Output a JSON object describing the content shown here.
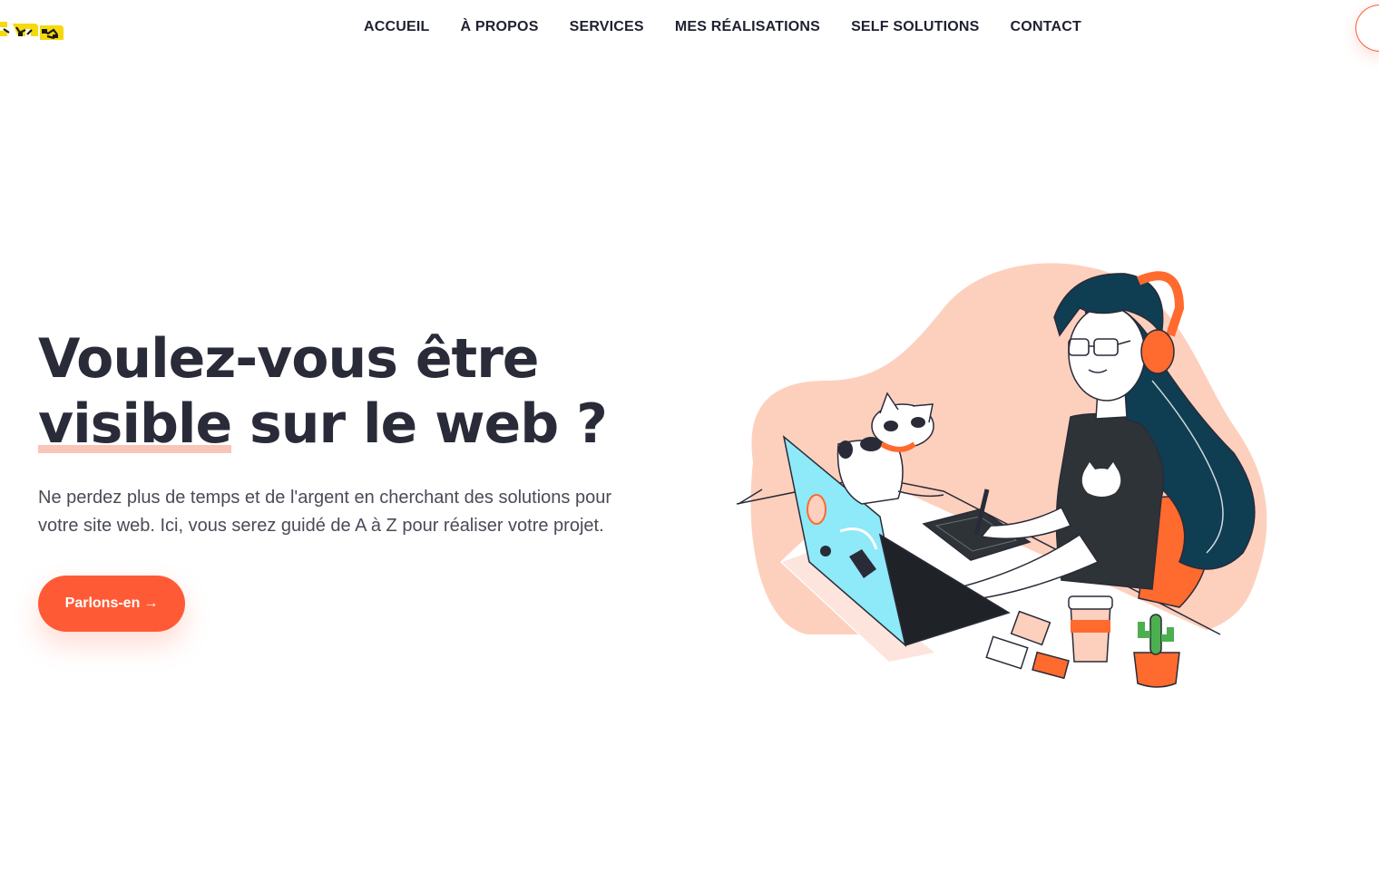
{
  "brand": {
    "logo_icon": "logo-mark",
    "accent": "#ff5a36",
    "logo_color": "#f5d90a"
  },
  "nav": {
    "items": [
      {
        "label": "ACCUEIL"
      },
      {
        "label": "À PROPOS"
      },
      {
        "label": "SERVICES"
      },
      {
        "label": "MES RÉALISATIONS"
      },
      {
        "label": "SELF SOLUTIONS"
      },
      {
        "label": "CONTACT"
      }
    ]
  },
  "hero": {
    "title_line1": "Voulez-vous être",
    "title_highlight": "visible",
    "title_rest": " sur le web ?",
    "text": "Ne perdez plus de temps et de l'argent en cherchant des solutions pour votre site web. Ici, vous serez guidé de A à Z pour réaliser votre projet.",
    "cta_label": "Parlons-en",
    "cta_icon": "→"
  },
  "illustration": {
    "name": "woman-working-on-laptop-with-cat"
  }
}
